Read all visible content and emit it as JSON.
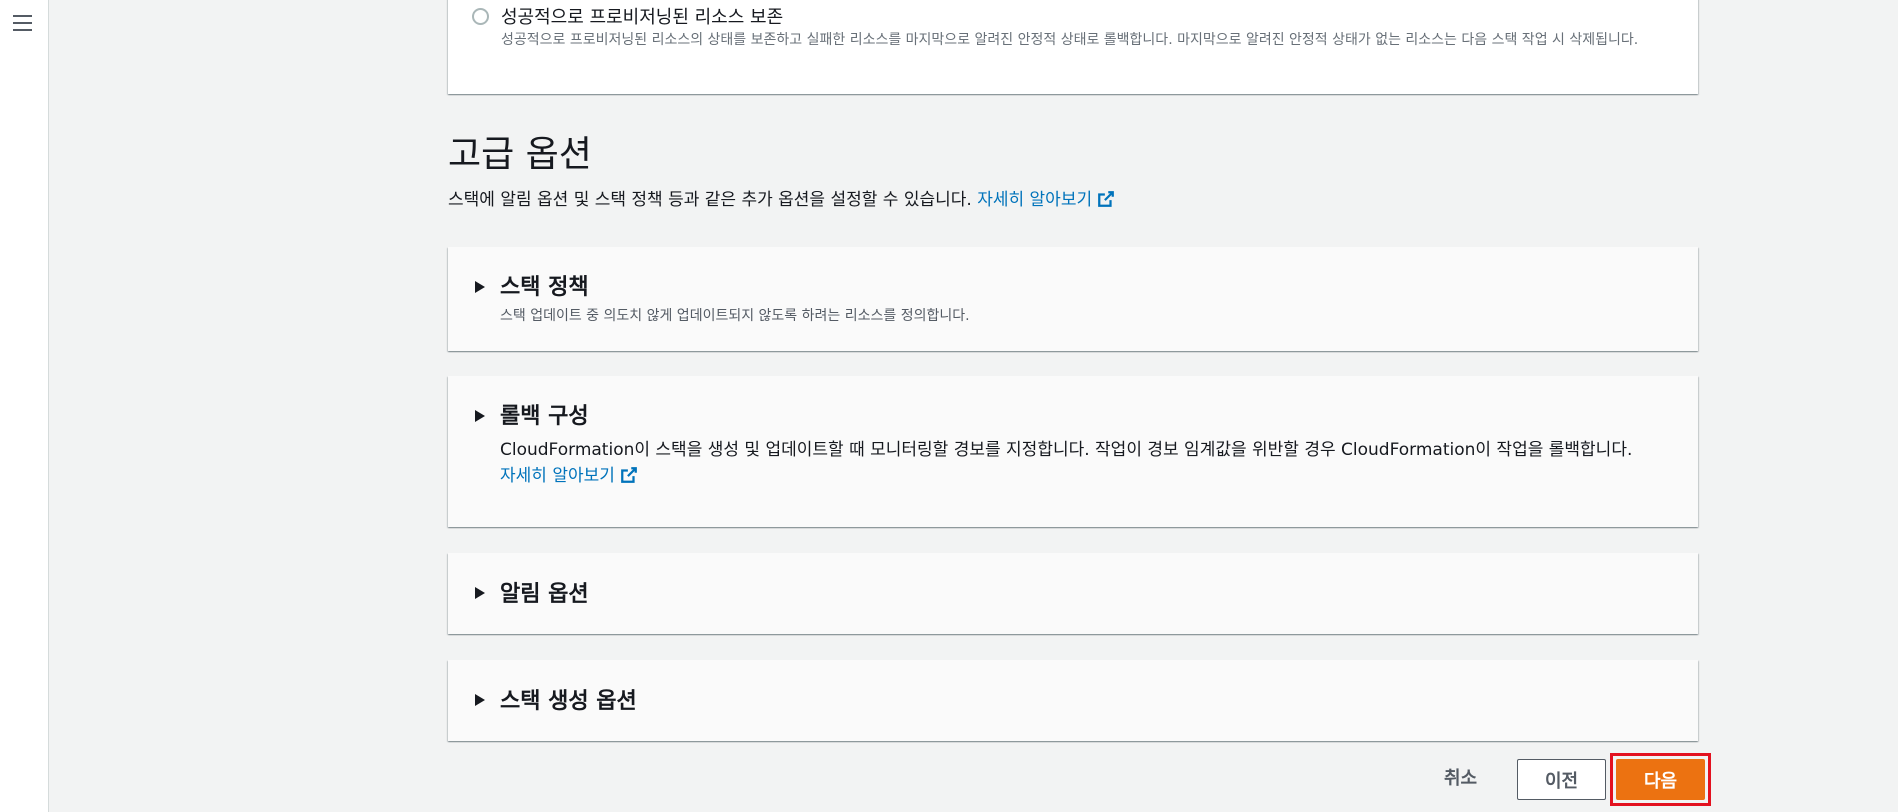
{
  "radio_option": {
    "label": "성공적으로 프로비저닝된 리소스 보존",
    "description": "성공적으로 프로비저닝된 리소스의 상태를 보존하고 실패한 리소스를 마지막으로 알려진 안정적 상태로 롤백합니다. 마지막으로 알려진 안정적 상태가 없는 리소스는 다음 스택 작업 시 삭제됩니다."
  },
  "advanced": {
    "title": "고급 옵션",
    "description": "스택에 알림 옵션 및 스택 정책 등과 같은 추가 옵션을 설정할 수 있습니다.",
    "learn_more": "자세히 알아보기"
  },
  "sections": {
    "stack_policy": {
      "title": "스택 정책",
      "description": "스택 업데이트 중 의도치 않게 업데이트되지 않도록 하려는 리소스를 정의합니다."
    },
    "rollback": {
      "title": "롤백 구성",
      "description": "CloudFormation이 스택을 생성 및 업데이트할 때 모니터링할 경보를 지정합니다. 작업이 경보 임계값을 위반할 경우 CloudFormation이 작업을 롤백합니다.",
      "learn_more": "자세히 알아보기"
    },
    "notification": {
      "title": "알림 옵션"
    },
    "creation": {
      "title": "스택 생성 옵션"
    }
  },
  "footer": {
    "cancel": "취소",
    "previous": "이전",
    "next": "다음"
  },
  "colors": {
    "primary": "#ec7211",
    "link": "#0073bb",
    "highlight": "#e3111f"
  }
}
